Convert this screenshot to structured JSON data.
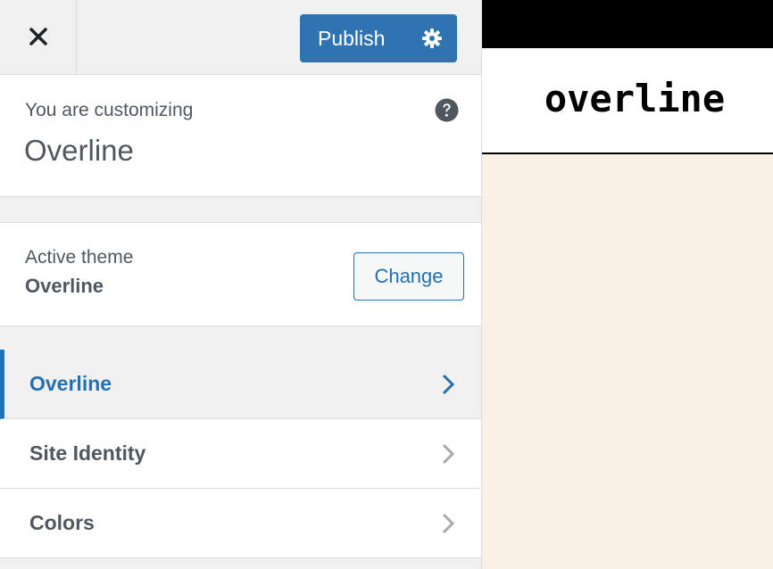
{
  "header": {
    "close_icon": "close-icon",
    "publish_label": "Publish",
    "settings_icon": "gear-icon",
    "accent_color": "#2f73b1"
  },
  "info": {
    "customizing_label": "You are customizing",
    "site_name": "Overline",
    "help_icon": "help-icon"
  },
  "theme": {
    "label": "Active theme",
    "name": "Overline",
    "change_label": "Change"
  },
  "nav": {
    "items": [
      {
        "label": "Overline",
        "active": true
      },
      {
        "label": "Site Identity",
        "active": false
      },
      {
        "label": "Colors",
        "active": false
      }
    ]
  },
  "preview": {
    "site_title": "overline",
    "background_color": "#faf0e6"
  }
}
